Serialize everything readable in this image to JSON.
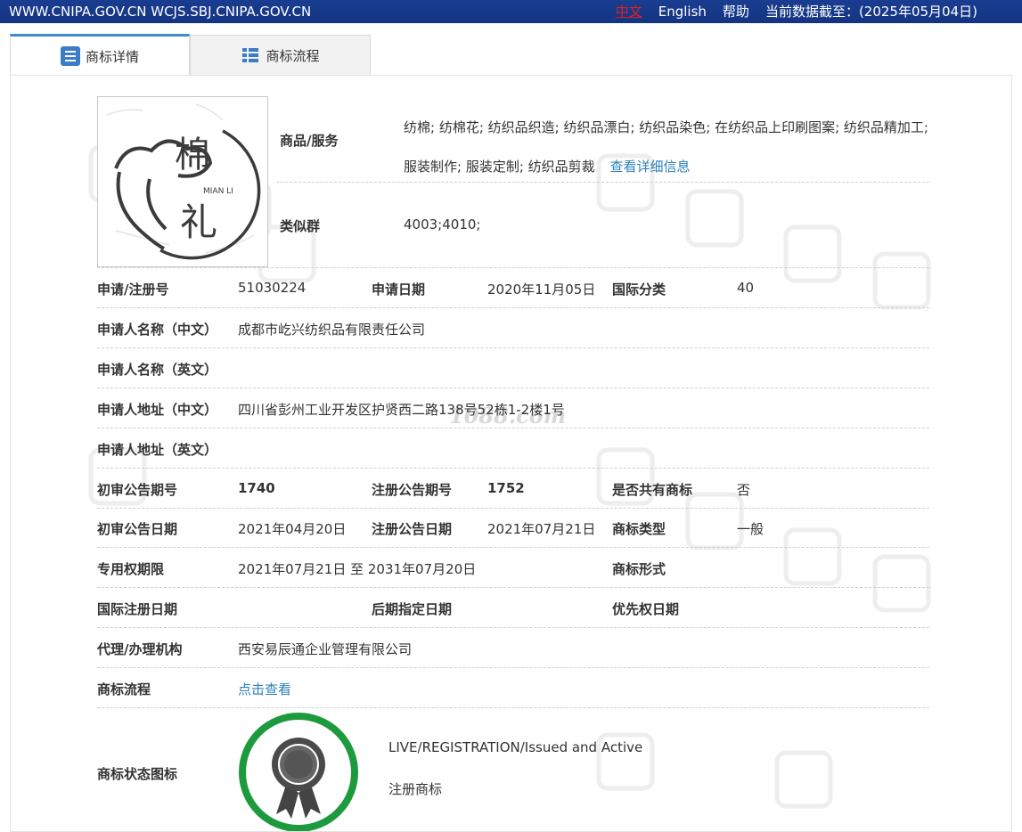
{
  "topbar": {
    "site": "WWW.CNIPA.GOV.CN WCJS.SBJ.CNIPA.GOV.CN",
    "lang_zh": "中文",
    "lang_en": "English",
    "help": "帮助",
    "data_date": "当前数据截至：(2025年05月04日)"
  },
  "tabs": [
    {
      "label": "商标详情",
      "icon": "list-doc-icon"
    },
    {
      "label": "商标流程",
      "icon": "list-grid-icon"
    }
  ],
  "logo": {
    "text_main": "棉",
    "text_second": "礼",
    "text_small": "MIAN LI"
  },
  "goods": {
    "label": "商品/服务",
    "value": "纺棉; 纺棉花; 纺织品织造; 纺织品漂白; 纺织品染色; 在纺织品上印刷图案; 纺织品精加工; 服装制作; 服装定制; 纺织品剪裁",
    "more_link": "查看详细信息"
  },
  "similar_group": {
    "label": "类似群",
    "value": "4003;4010;"
  },
  "rows": {
    "reg_no": {
      "label": "申请/注册号",
      "value": "51030224"
    },
    "apply_date": {
      "label": "申请日期",
      "value": "2020年11月05日"
    },
    "intl_class": {
      "label": "国际分类",
      "value": "40"
    },
    "applicant_cn": {
      "label": "申请人名称（中文）",
      "value": "成都市屹兴纺织品有限责任公司"
    },
    "applicant_en": {
      "label": "申请人名称（英文）",
      "value": ""
    },
    "address_cn": {
      "label": "申请人地址（中文）",
      "value": "四川省彭州工业开发区护贤西二路138号52栋1-2楼1号"
    },
    "address_en": {
      "label": "申请人地址（英文）",
      "value": ""
    },
    "prelim_issue": {
      "label": "初审公告期号",
      "value": "1740"
    },
    "reg_issue": {
      "label": "注册公告期号",
      "value": "1752"
    },
    "shared": {
      "label": "是否共有商标",
      "value": "否"
    },
    "prelim_date": {
      "label": "初审公告日期",
      "value": "2021年04月20日"
    },
    "reg_date": {
      "label": "注册公告日期",
      "value": "2021年07月21日"
    },
    "tm_type": {
      "label": "商标类型",
      "value": "一般"
    },
    "exclusive": {
      "label": "专用权期限",
      "value": "2021年07月21日 至 2031年07月20日"
    },
    "tm_form": {
      "label": "商标形式",
      "value": ""
    },
    "intl_reg_date": {
      "label": "国际注册日期",
      "value": ""
    },
    "later_date": {
      "label": "后期指定日期",
      "value": ""
    },
    "priority_date": {
      "label": "优先权日期",
      "value": ""
    },
    "agent": {
      "label": "代理/办理机构",
      "value": "西安易辰通企业管理有限公司"
    },
    "process": {
      "label": "商标流程",
      "value": "点击查看"
    }
  },
  "status": {
    "label": "商标状态图标",
    "en": "LIVE/REGISTRATION/Issued and Active",
    "cn": "注册商标",
    "ring_color": "#1e9a3e"
  },
  "watermark_text": "1088.com"
}
